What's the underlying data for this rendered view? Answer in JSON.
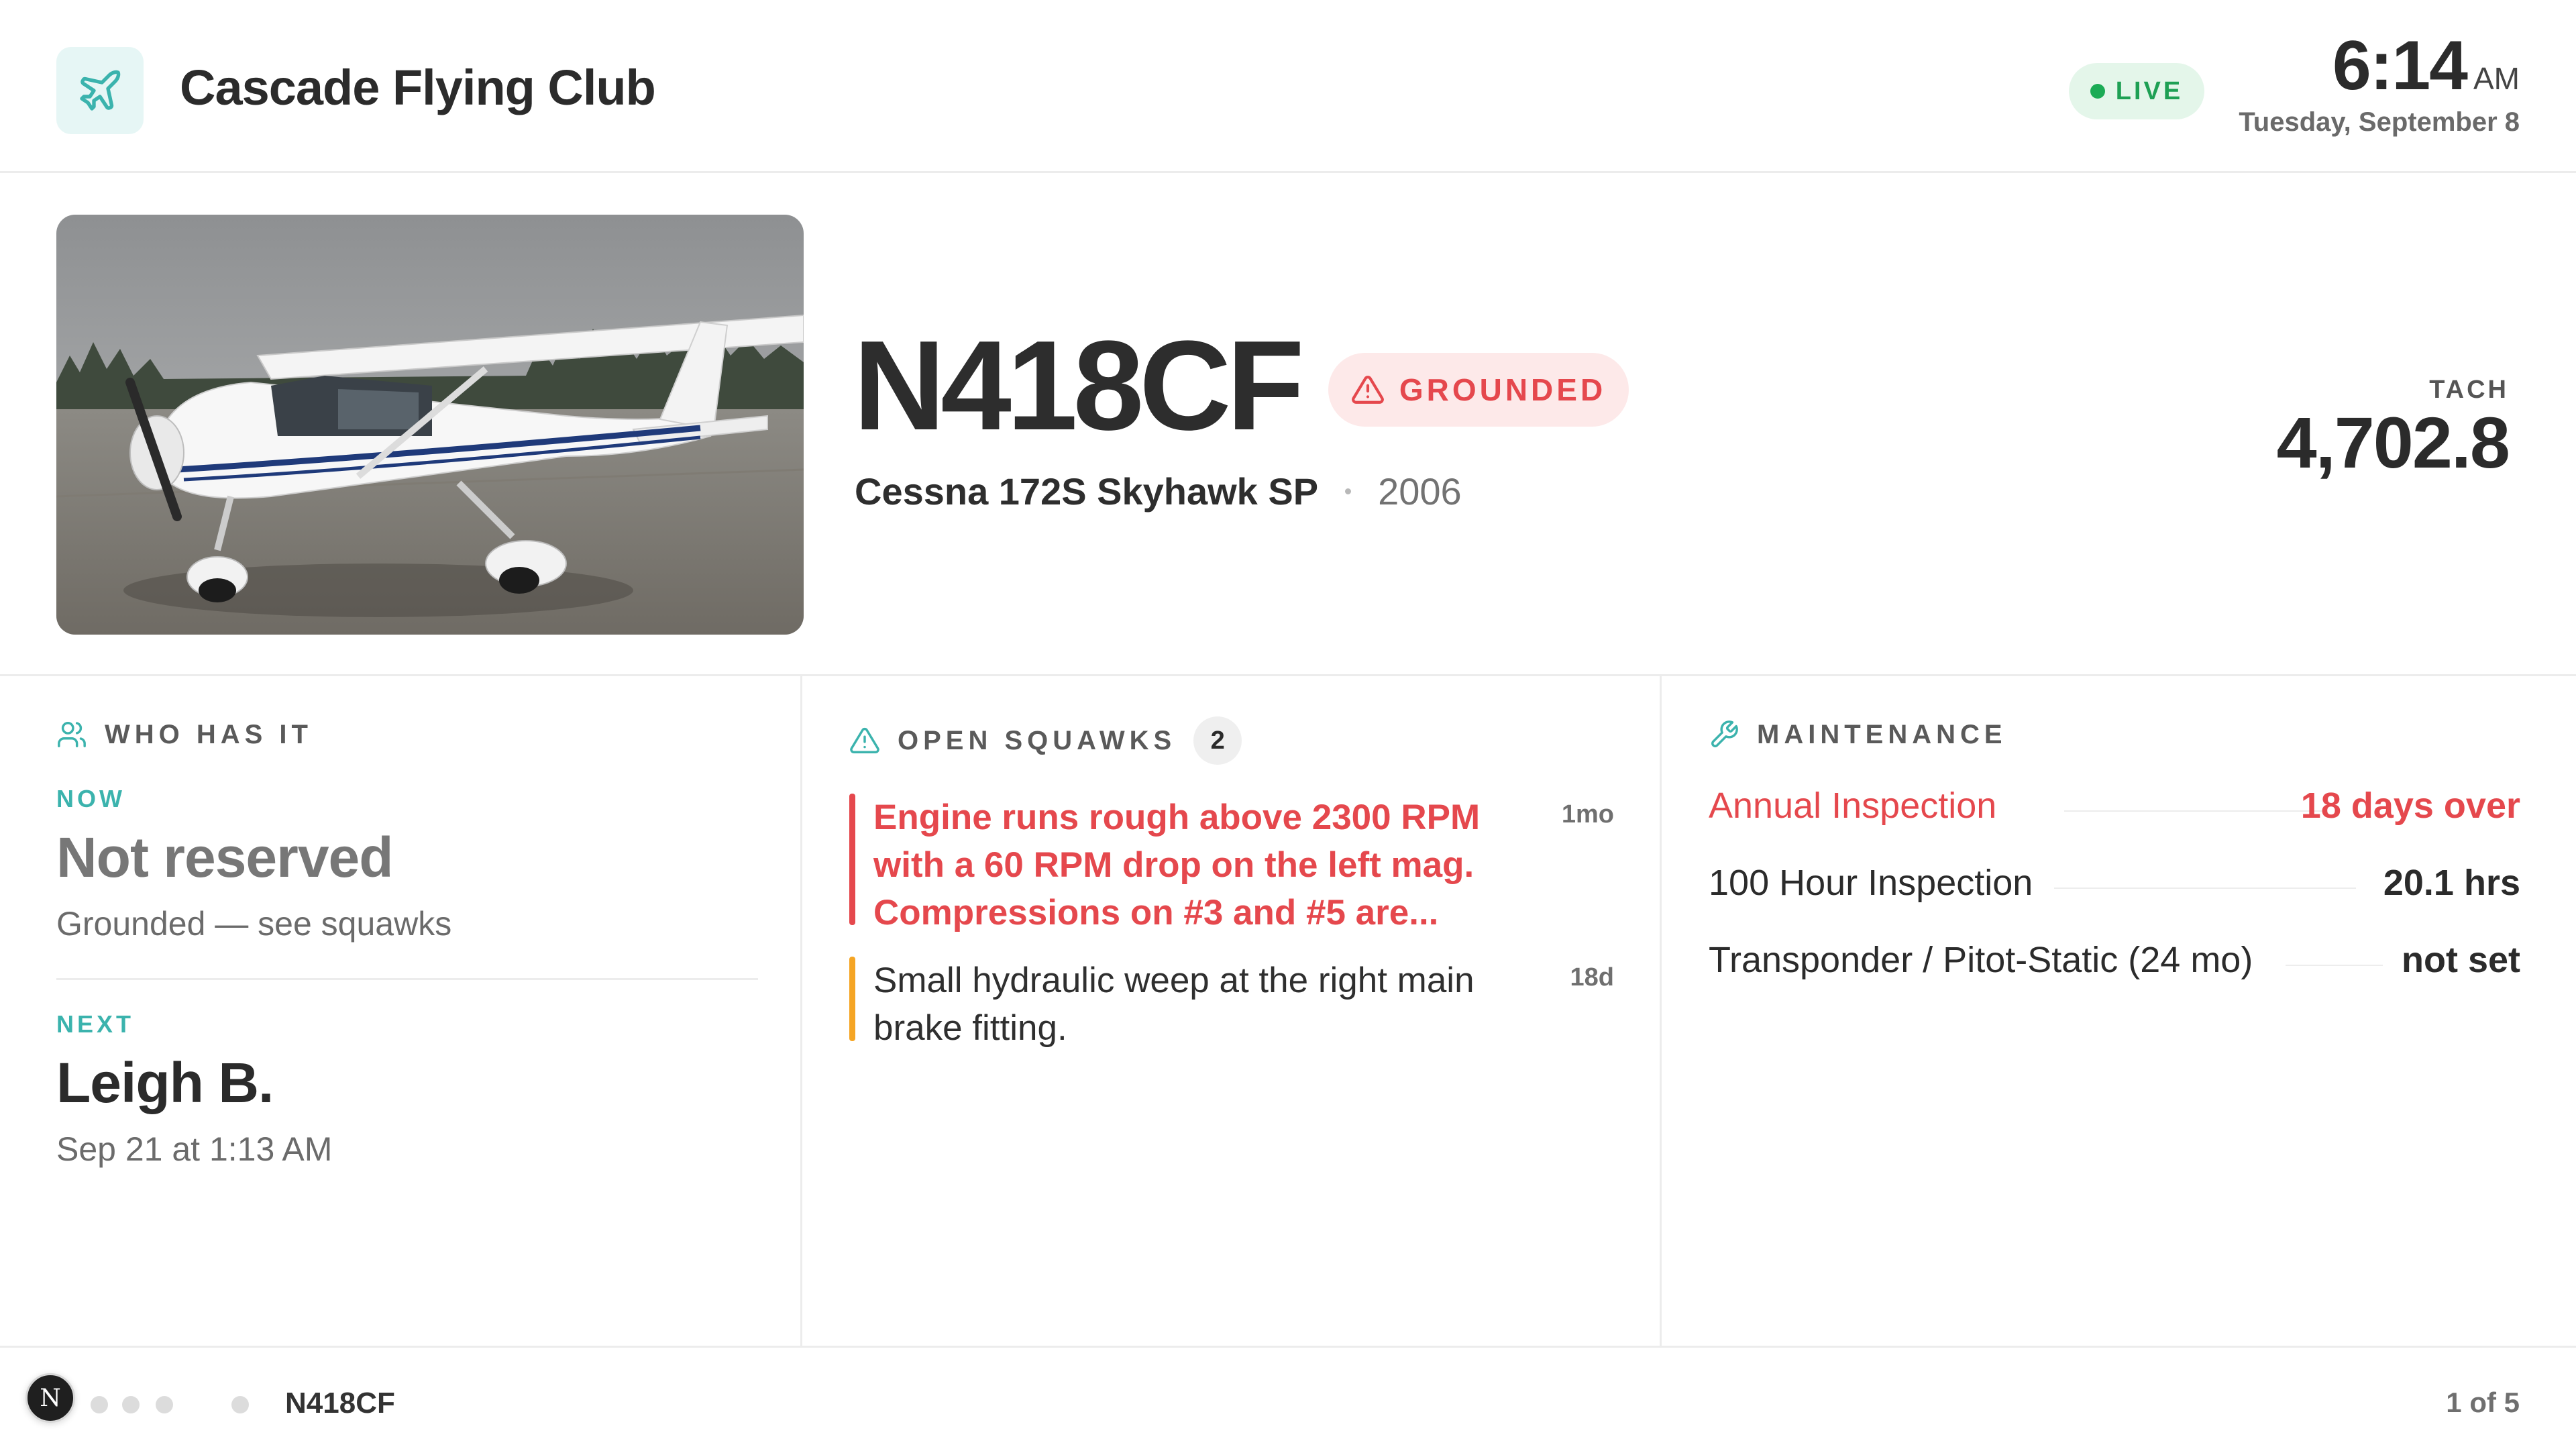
{
  "header": {
    "club_name": "Cascade Flying Club",
    "live_label": "LIVE",
    "time": "6:14",
    "ampm": "AM",
    "date": "Tuesday, September 8"
  },
  "aircraft": {
    "tail_number": "N418CF",
    "status": "GROUNDED",
    "model": "Cessna 172S Skyhawk SP",
    "year": "2006",
    "tach_label": "TACH",
    "tach_value": "4,702.8"
  },
  "who_has_it": {
    "title": "WHO HAS IT",
    "now_label": "NOW",
    "now_status": "Not reserved",
    "now_sub": "Grounded — see squawks",
    "next_label": "NEXT",
    "next_name": "Leigh B.",
    "next_time": "Sep 21 at 1:13 AM"
  },
  "squawks": {
    "title": "OPEN SQUAWKS",
    "count": "2",
    "items": [
      {
        "text": "Engine runs rough above 2300 RPM with a 60 RPM drop on the left mag. Compressions on #3 and #5 are...",
        "age": "1mo",
        "severity": "grounding",
        "color": "#e5484d"
      },
      {
        "text": "Small hydraulic weep at the right main brake fitting.",
        "age": "18d",
        "severity": "minor",
        "color": "#f5a524"
      }
    ]
  },
  "maintenance": {
    "title": "MAINTENANCE",
    "items": [
      {
        "name": "Annual Inspection",
        "value": "18 days over",
        "status": "overdue"
      },
      {
        "name": "100 Hour Inspection",
        "value": "20.1 hrs",
        "status": "ok"
      },
      {
        "name": "Transponder / Pitot-Static (24 mo)",
        "value": "not set",
        "status": "unset"
      }
    ]
  },
  "footer": {
    "badge_letter": "N",
    "tail_number": "N418CF",
    "page_indicator": "1 of 5"
  },
  "colors": {
    "accent_teal": "#3bb3ad",
    "danger": "#e5484d",
    "warning": "#f5a524",
    "live_green": "#1ea054"
  }
}
